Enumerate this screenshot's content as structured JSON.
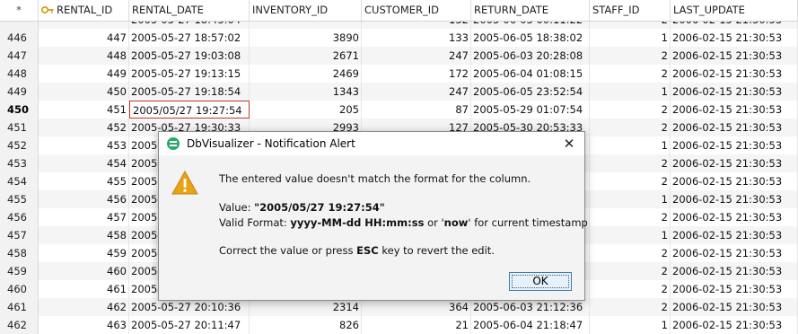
{
  "grid": {
    "header": {
      "star": "*",
      "columns": [
        "RENTAL_ID",
        "RENTAL_DATE",
        "INVENTORY_ID",
        "CUSTOMER_ID",
        "RETURN_DATE",
        "STAFF_ID",
        "LAST_UPDATE"
      ]
    },
    "partial_top_row": {
      "rental_date": "2005-05-27 18:43:04",
      "customer_id": "132",
      "return_date": "2005-06-03 00:11:22",
      "staff_id": "2",
      "last_update": "2006-02-15 21:30:53"
    },
    "rows": [
      {
        "rn": "446",
        "rental_id": "447",
        "rental_date": "2005-05-27 18:57:02",
        "inventory_id": "3890",
        "customer_id": "133",
        "return_date": "2005-06-05 18:38:02",
        "staff_id": "1",
        "last_update": "2006-02-15 21:30:53"
      },
      {
        "rn": "447",
        "rental_id": "448",
        "rental_date": "2005-05-27 19:03:08",
        "inventory_id": "2671",
        "customer_id": "247",
        "return_date": "2005-06-03 20:28:08",
        "staff_id": "2",
        "last_update": "2006-02-15 21:30:53"
      },
      {
        "rn": "448",
        "rental_id": "449",
        "rental_date": "2005-05-27 19:13:15",
        "inventory_id": "2469",
        "customer_id": "172",
        "return_date": "2005-06-04 01:08:15",
        "staff_id": "2",
        "last_update": "2006-02-15 21:30:53"
      },
      {
        "rn": "449",
        "rental_id": "450",
        "rental_date": "2005-05-27 19:18:54",
        "inventory_id": "1343",
        "customer_id": "247",
        "return_date": "2005-06-05 23:52:54",
        "staff_id": "1",
        "last_update": "2006-02-15 21:30:53"
      },
      {
        "rn": "450",
        "rental_id": "451",
        "rental_date": "2005/05/27 19:27:54",
        "inventory_id": "205",
        "customer_id": "87",
        "return_date": "2005-05-29 01:07:54",
        "staff_id": "2",
        "last_update": "2006-02-15 21:30:53"
      },
      {
        "rn": "451",
        "rental_id": "452",
        "rental_date": "2005-05-27 19:30:33",
        "inventory_id": "2993",
        "customer_id": "127",
        "return_date": "2005-05-30 20:53:33",
        "staff_id": "2",
        "last_update": "2006-02-15 21:30:53"
      },
      {
        "rn": "452",
        "rental_id": "453",
        "rental_date": "2005-",
        "inventory_id": "",
        "customer_id": "",
        "return_date": "",
        "staff_id": "1",
        "last_update": "2006-02-15 21:30:53"
      },
      {
        "rn": "453",
        "rental_id": "454",
        "rental_date": "2005-",
        "inventory_id": "",
        "customer_id": "",
        "return_date": "",
        "staff_id": "2",
        "last_update": "2006-02-15 21:30:53"
      },
      {
        "rn": "454",
        "rental_id": "455",
        "rental_date": "2005-",
        "inventory_id": "",
        "customer_id": "",
        "return_date": "",
        "staff_id": "2",
        "last_update": "2006-02-15 21:30:53"
      },
      {
        "rn": "455",
        "rental_id": "456",
        "rental_date": "2005-",
        "inventory_id": "",
        "customer_id": "",
        "return_date": "",
        "staff_id": "1",
        "last_update": "2006-02-15 21:30:53"
      },
      {
        "rn": "456",
        "rental_id": "457",
        "rental_date": "2005-",
        "inventory_id": "",
        "customer_id": "",
        "return_date": "",
        "staff_id": "2",
        "last_update": "2006-02-15 21:30:53"
      },
      {
        "rn": "457",
        "rental_id": "458",
        "rental_date": "2005-",
        "inventory_id": "",
        "customer_id": "",
        "return_date": "",
        "staff_id": "1",
        "last_update": "2006-02-15 21:30:53"
      },
      {
        "rn": "458",
        "rental_id": "459",
        "rental_date": "2005-",
        "inventory_id": "",
        "customer_id": "",
        "return_date": "",
        "staff_id": "2",
        "last_update": "2006-02-15 21:30:53"
      },
      {
        "rn": "459",
        "rental_id": "460",
        "rental_date": "2005-",
        "inventory_id": "",
        "customer_id": "",
        "return_date": "",
        "staff_id": "2",
        "last_update": "2006-02-15 21:30:53"
      },
      {
        "rn": "460",
        "rental_id": "461",
        "rental_date": "2005-",
        "inventory_id": "",
        "customer_id": "",
        "return_date": "",
        "staff_id": "2",
        "last_update": "2006-02-15 21:30:53"
      },
      {
        "rn": "461",
        "rental_id": "462",
        "rental_date": "2005-05-27 20:10:36",
        "inventory_id": "2314",
        "customer_id": "364",
        "return_date": "2005-06-03 21:12:36",
        "staff_id": "2",
        "last_update": "2006-02-15 21:30:53"
      },
      {
        "rn": "462",
        "rental_id": "463",
        "rental_date": "2005-05-27 20:11:47",
        "inventory_id": "826",
        "customer_id": "21",
        "return_date": "2005-06-04 21:18:47",
        "staff_id": "1",
        "last_update": "2006-02-15 21:30:53"
      }
    ]
  },
  "dialog": {
    "title": "DbVisualizer - Notification Alert",
    "close_glyph": "✕",
    "message1": "The entered value doesn't match the format for the column.",
    "value_label": "Value: ",
    "value": "\"2005/05/27 19:27:54\"",
    "format_label": "Valid Format: ",
    "format": "yyyy-MM-dd HH:mm:ss",
    "or_text": " or '",
    "now_word": "now",
    "current_text": "' for current timestamp",
    "correct_prefix": "Correct the value or press ",
    "esc_key": "ESC",
    "correct_suffix": " key to revert the edit.",
    "ok_label": "OK",
    "icon": "warning-icon"
  }
}
